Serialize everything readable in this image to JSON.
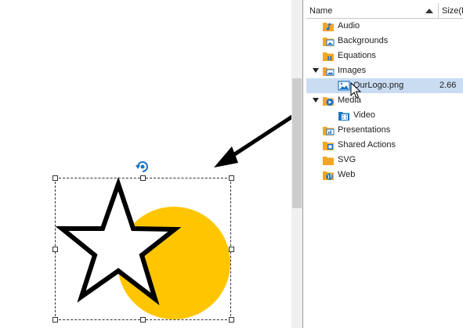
{
  "panel": {
    "columns": {
      "name": "Name",
      "size": "Size(K"
    },
    "items": [
      {
        "label": "Audio",
        "icon": "audio-folder-icon"
      },
      {
        "label": "Backgrounds",
        "icon": "backgrounds-folder-icon"
      },
      {
        "label": "Equations",
        "icon": "equations-folder-icon"
      },
      {
        "label": "Images",
        "icon": "images-folder-icon",
        "expanded": true
      },
      {
        "label": "OurLogo.png",
        "icon": "image-file-icon",
        "size": "2.66",
        "selected": true
      },
      {
        "label": "Media",
        "icon": "media-folder-icon",
        "expanded": true
      },
      {
        "label": "Video",
        "icon": "video-folder-icon"
      },
      {
        "label": "Presentations",
        "icon": "presentations-folder-icon"
      },
      {
        "label": "Shared Actions",
        "icon": "shared-actions-folder-icon"
      },
      {
        "label": "SVG",
        "icon": "svg-folder-icon"
      },
      {
        "label": "Web",
        "icon": "web-folder-icon"
      }
    ]
  },
  "canvas": {
    "shapes": [
      "star",
      "circle"
    ],
    "colors": {
      "circle": "#ffc600",
      "star_stroke": "#000000",
      "selection": "#333333",
      "arrow": "#000000"
    }
  },
  "colors": {
    "folder": "#f5a623",
    "selected_row": "#c9dcf2",
    "icon_blue": "#1c74c4"
  }
}
